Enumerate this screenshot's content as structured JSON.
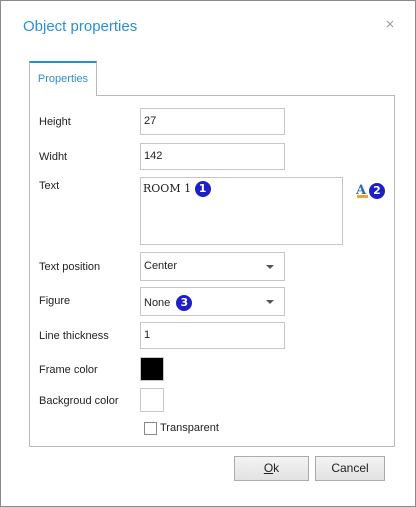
{
  "dialog": {
    "title": "Object properties",
    "close_glyph": "×"
  },
  "tabs": [
    {
      "label": "Properties",
      "active": true
    }
  ],
  "fields": {
    "height": {
      "label": "Height",
      "value": "27"
    },
    "width": {
      "label": "Widht",
      "value": "142"
    },
    "text": {
      "label": "Text",
      "value": "ROOM 1"
    },
    "text_position": {
      "label": "Text position",
      "value": "Center"
    },
    "figure": {
      "label": "Figure",
      "value": "None"
    },
    "line_thickness": {
      "label": "Line thickness",
      "value": "1"
    },
    "frame_color": {
      "label": "Frame color",
      "value": "#000000"
    },
    "background_color": {
      "label": "Backgroud color",
      "value": "#ffffff"
    },
    "transparent": {
      "label": "Transparent",
      "checked": false
    }
  },
  "annotations": {
    "badge1": "1",
    "badge2": "2",
    "badge3": "3",
    "badge_color": "#1d1fc7"
  },
  "icons": {
    "font_settings": "font-style-icon"
  },
  "buttons": {
    "ok_first": "O",
    "ok_rest": "k",
    "cancel": "Cancel"
  },
  "colors": {
    "accent": "#2b8fd6"
  }
}
